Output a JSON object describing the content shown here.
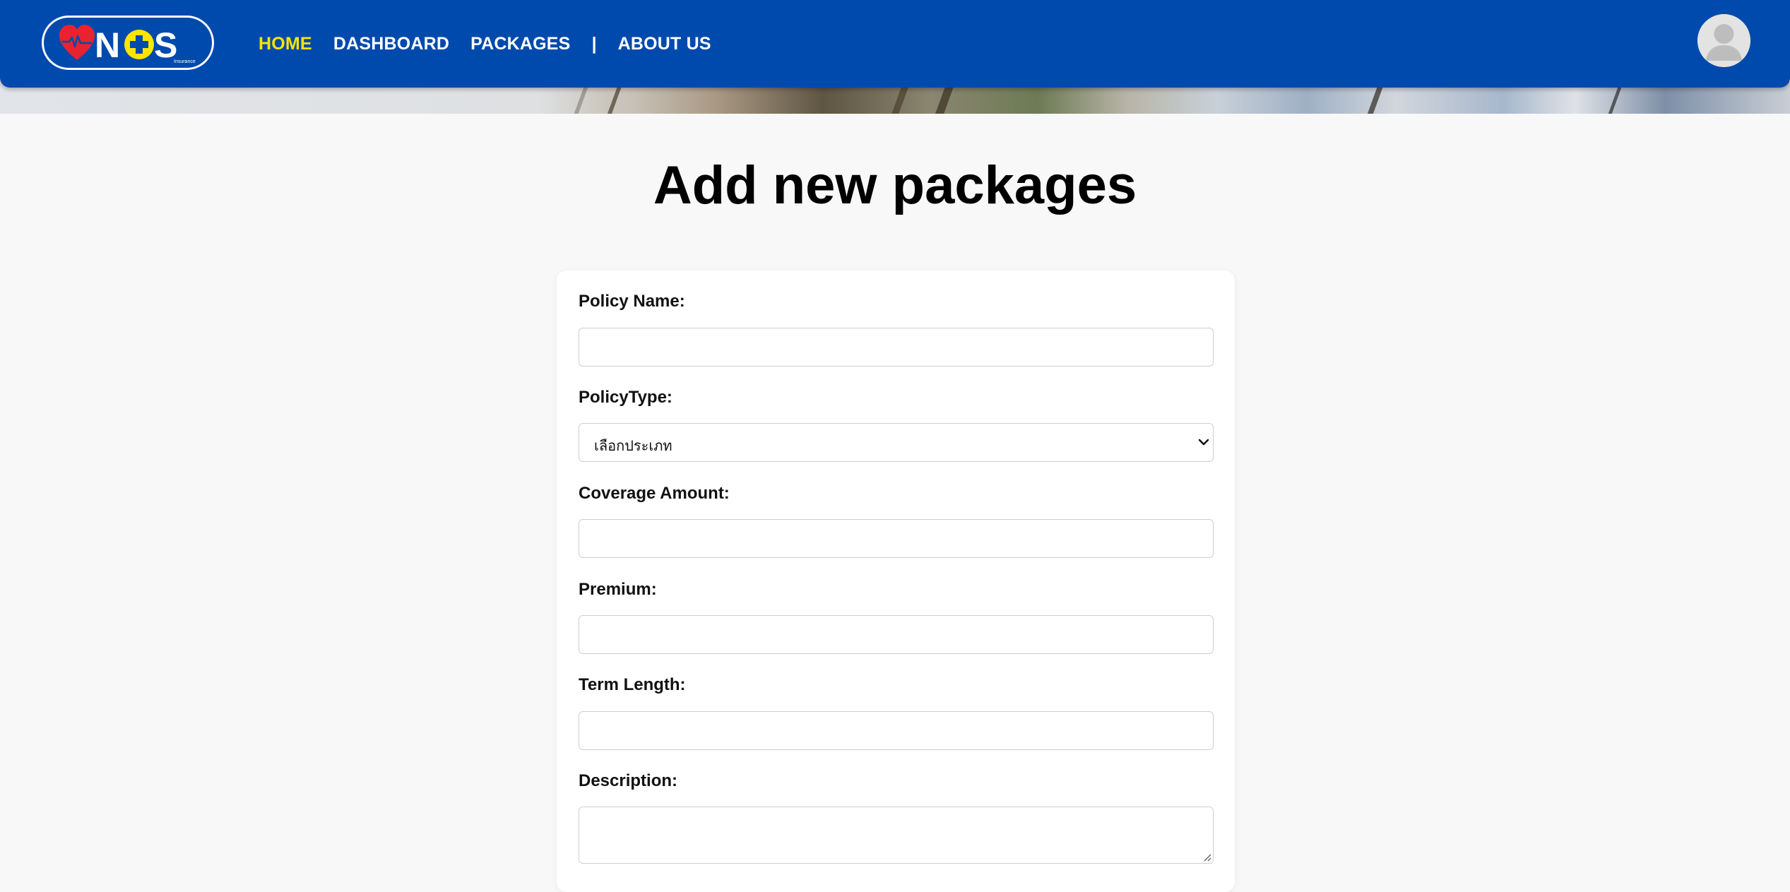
{
  "header": {
    "logo_text": "NOS",
    "logo_subtext": "Insurance",
    "nav": [
      {
        "label": "HOME",
        "active": true
      },
      {
        "label": "DASHBOARD",
        "active": false
      },
      {
        "label": "PACKAGES",
        "active": false
      },
      {
        "label": "|",
        "separator": true
      },
      {
        "label": "ABOUT US",
        "active": false
      }
    ],
    "avatar_icon": "user-avatar-icon"
  },
  "page": {
    "title": "Add new packages"
  },
  "form": {
    "policy_name": {
      "label": "Policy Name:",
      "value": ""
    },
    "policy_type": {
      "label": "PolicyType:",
      "selected": "เลือกประเภท"
    },
    "coverage_amount": {
      "label": "Coverage Amount:",
      "value": ""
    },
    "premium": {
      "label": "Premium:",
      "value": ""
    },
    "term_length": {
      "label": "Term Length:",
      "value": ""
    },
    "description": {
      "label": "Description:",
      "value": ""
    }
  },
  "colors": {
    "navbar": "#004aad",
    "active_link": "#ffe500",
    "logo_heart": "#e8232f",
    "logo_plus_circle": "#ffe500"
  }
}
